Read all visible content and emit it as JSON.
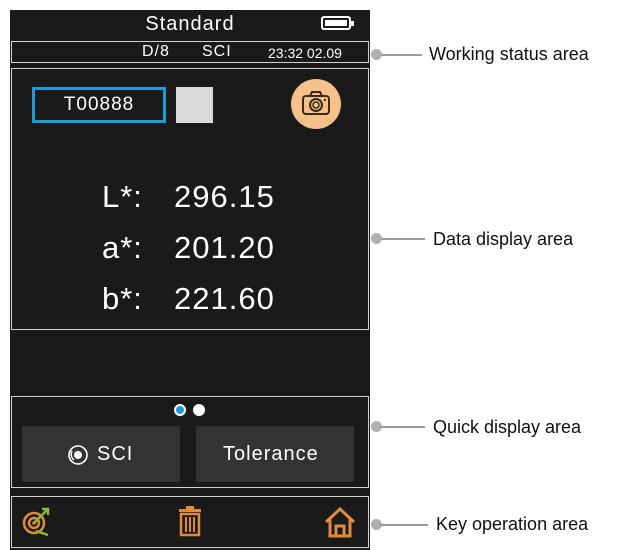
{
  "device": {
    "mode_title": "Standard",
    "battery_icon": "battery-full-icon",
    "status": {
      "geometry": "D/8",
      "mode": "SCI",
      "datetime": "23:32 02.09"
    },
    "sample": {
      "name": "T00888",
      "swatch_color": "#d9d9d9"
    },
    "camera_icon": "camera-icon",
    "readings": [
      {
        "label": "L*:",
        "value": "296.15"
      },
      {
        "label": "a*:",
        "value": "201.20"
      },
      {
        "label": "b*:",
        "value": "221.60"
      }
    ],
    "pager_dots": 2,
    "pager_active": 1,
    "quick_buttons": {
      "sci": "SCI",
      "tolerance": "Tolerance"
    },
    "keys": [
      "target-icon",
      "trash-icon",
      "home-icon"
    ]
  },
  "callouts": {
    "working_status": "Working status area",
    "data_display": "Data display area",
    "quick_display": "Quick display area",
    "key_operation": "Key operation area"
  },
  "colors": {
    "accent": "#1e9bd7",
    "icon_orange": "#e08a3c",
    "screen": "#1a1a1a"
  }
}
